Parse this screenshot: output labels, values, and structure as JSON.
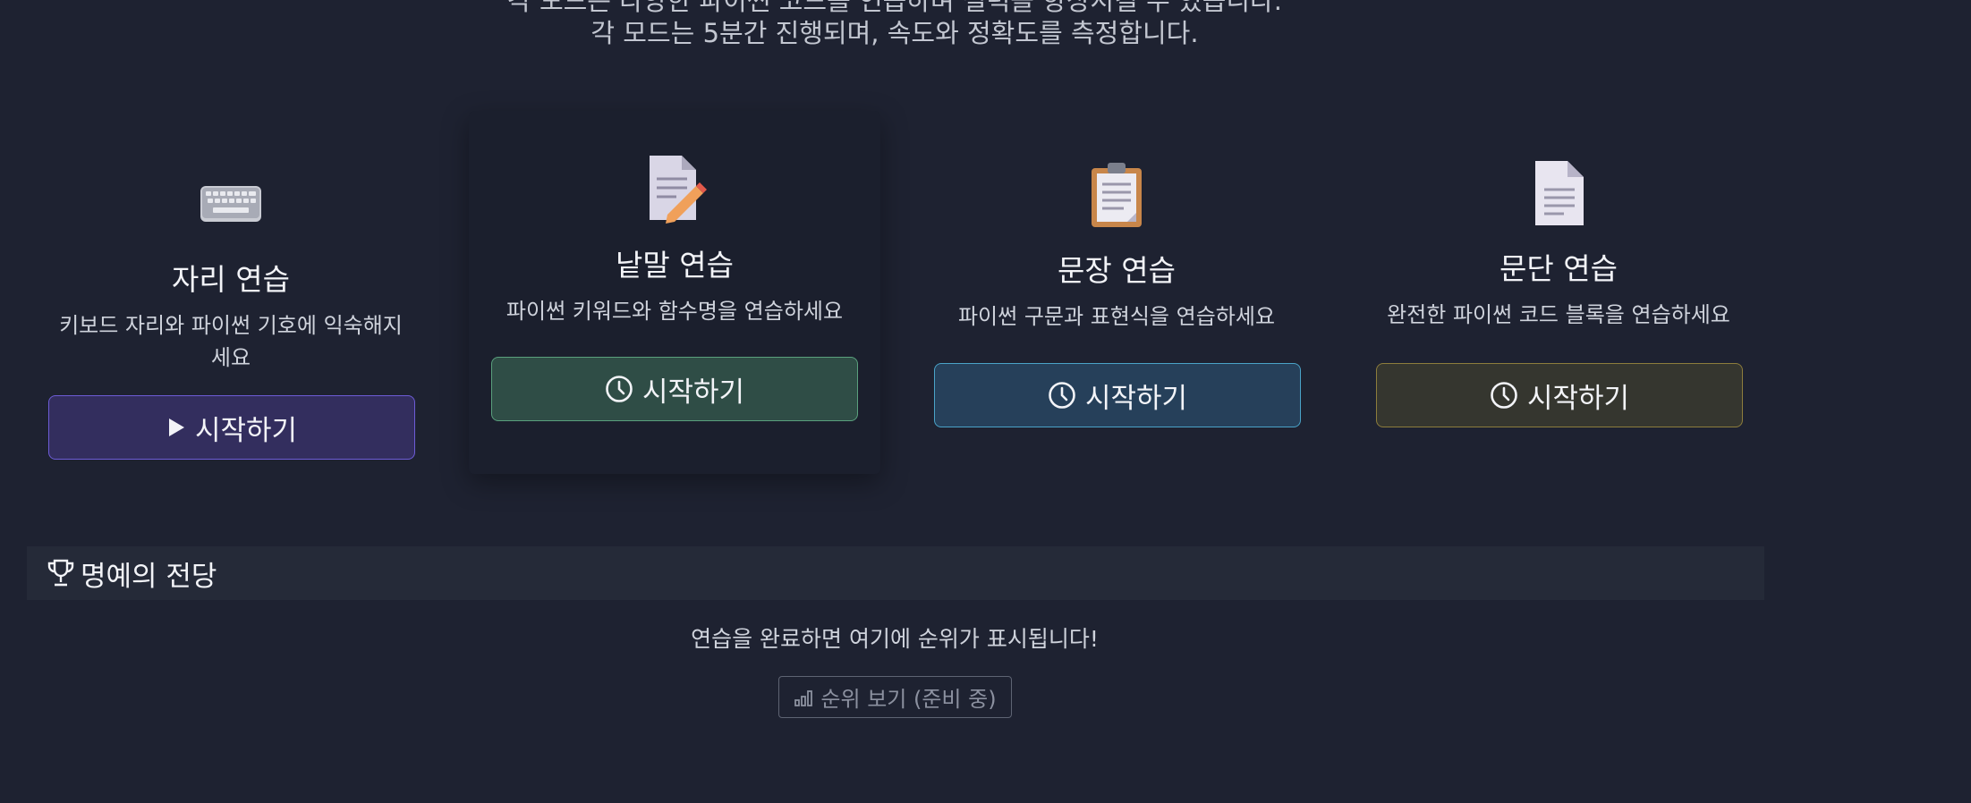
{
  "intro": {
    "line1": "각 모드는 다양한 파이썬 코드를 연습하며 실력을 향상시킬 수 있습니다.",
    "line2": "각 모드는 5분간 진행되며, 속도와 정확도를 측정합니다."
  },
  "modes": [
    {
      "icon": "keyboard-icon",
      "title": "자리 연습",
      "desc_line1": "키보드 자리와 파이썬 기호에 익숙해지",
      "desc_line2": "세요",
      "button_icon": "play-icon",
      "button_label": "시작하기",
      "accent": "#6d5cd6"
    },
    {
      "icon": "memo-icon",
      "title": "낱말 연습",
      "desc_line1": "파이썬 키워드와 함수명을 연습하세요",
      "button_icon": "clock-icon",
      "button_label": "시작하기",
      "accent": "#5aa07d"
    },
    {
      "icon": "clipboard-icon",
      "title": "문장 연습",
      "desc_line1": "파이썬 구문과 표현식을 연습하세요",
      "button_icon": "clock-icon",
      "button_label": "시작하기",
      "accent": "#4aa3c8"
    },
    {
      "icon": "document-icon",
      "title": "문단 연습",
      "desc_line1": "완전한 파이썬 코드 블록을 연습하세요",
      "button_icon": "clock-icon",
      "button_label": "시작하기",
      "accent": "#8d7d3c"
    }
  ],
  "hall_of_fame": {
    "icon": "trophy-icon",
    "title": "명예의 전당",
    "message": "연습을 완료하면 여기에 순위가 표시됩니다!",
    "rank_button_icon": "bar-chart-icon",
    "rank_button_label": "순위 보기 (준비 중)"
  }
}
